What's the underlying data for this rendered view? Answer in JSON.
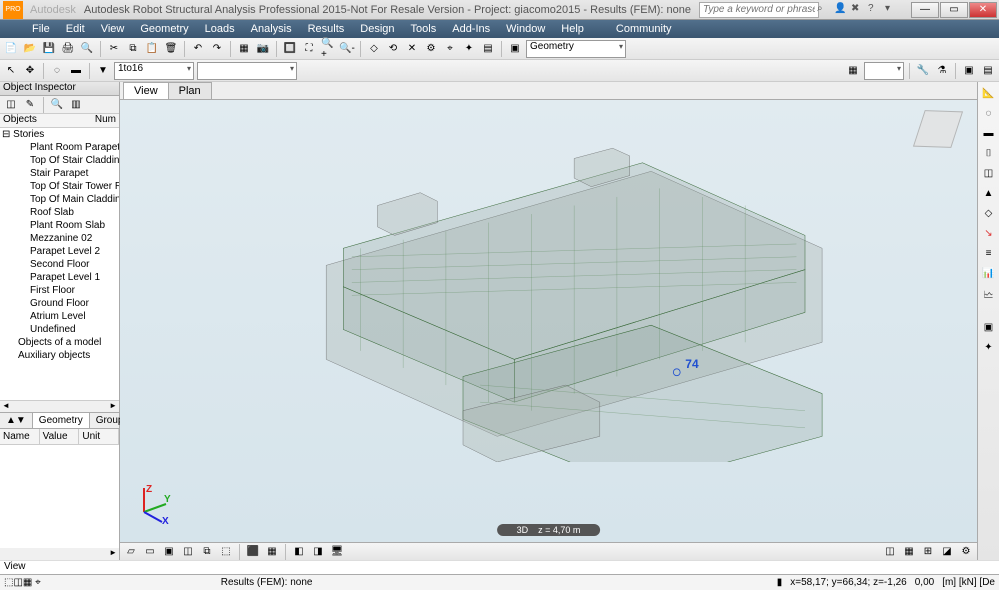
{
  "titlebar": {
    "app_tag": "PRO",
    "ghost_text": "Autodesk",
    "title": "Autodesk Robot Structural Analysis Professional 2015-Not For Resale Version - Project: giacomo2015 - Results (FEM): none",
    "search_placeholder": "Type a keyword or phrase"
  },
  "menu": [
    "File",
    "Edit",
    "View",
    "Geometry",
    "Loads",
    "Analysis",
    "Results",
    "Design",
    "Tools",
    "Add-Ins",
    "Window",
    "Help",
    "Community"
  ],
  "toolbar1": {
    "layout_combo": "Geometry"
  },
  "toolbar2": {
    "scale": "1to16"
  },
  "inspector": {
    "title": "Object Inspector",
    "head_objects": "Objects",
    "head_num": "Num",
    "root": "Stories",
    "children": [
      "Plant Room Parapet Level",
      "Top Of Stair Cladding",
      "Stair Parapet",
      "Top Of Stair Tower Roofs",
      "Top Of Main Cladding",
      "Roof Slab",
      "Plant Room Slab",
      "Mezzanine 02",
      "Parapet Level 2",
      "Second Floor",
      "Parapet Level 1",
      "First Floor",
      "Ground Floor",
      "Atrium Level",
      "Undefined"
    ],
    "extra": [
      "Objects of a model",
      "Auxiliary objects"
    ]
  },
  "bottom_tabs": {
    "t1": "▲▼",
    "t2": "Geometry",
    "t3": "Groups"
  },
  "propgrid": {
    "c1": "Name",
    "c2": "Value",
    "c3": "Unit"
  },
  "viewtabs": {
    "t1": "View",
    "t2": "Plan"
  },
  "zbar": {
    "mode": "3D",
    "label": "z = 4,70 m"
  },
  "status": {
    "left": "View",
    "results": "Results (FEM): none",
    "coords": "x=58,17; y=66,34; z=-1,26",
    "zero": "0,00",
    "units": "[m] [kN] [De"
  },
  "marker3d": "74"
}
